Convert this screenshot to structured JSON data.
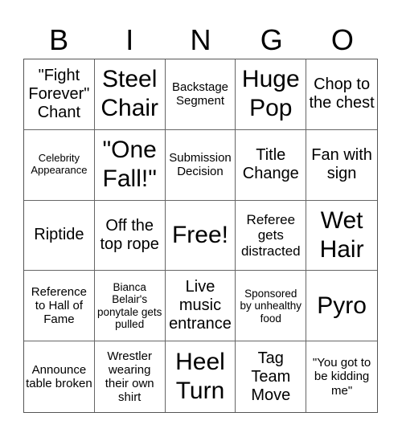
{
  "header": [
    "B",
    "I",
    "N",
    "G",
    "O"
  ],
  "cells": [
    {
      "text": "\"Fight Forever\" Chant",
      "size": "s2"
    },
    {
      "text": "Steel Chair",
      "size": "s1"
    },
    {
      "text": "Backstage Segment",
      "size": "s4"
    },
    {
      "text": "Huge Pop",
      "size": "s1"
    },
    {
      "text": "Chop to the chest",
      "size": "s2"
    },
    {
      "text": "Celebrity Appearance",
      "size": "s6"
    },
    {
      "text": "\"One Fall!\"",
      "size": "s1"
    },
    {
      "text": "Submission Decision",
      "size": "s4"
    },
    {
      "text": "Title Change",
      "size": "s2"
    },
    {
      "text": "Fan with sign",
      "size": "s2"
    },
    {
      "text": "Riptide",
      "size": "s2"
    },
    {
      "text": "Off the top rope",
      "size": "s2"
    },
    {
      "text": "Free!",
      "size": "s1"
    },
    {
      "text": "Referee gets distracted",
      "size": "s3"
    },
    {
      "text": "Wet Hair",
      "size": "s1"
    },
    {
      "text": "Reference to Hall of Fame",
      "size": "s4"
    },
    {
      "text": "Bianca Belair's ponytale gets pulled",
      "size": "s5"
    },
    {
      "text": "Live music entrance",
      "size": "s2"
    },
    {
      "text": "Sponsored by unhealthy food",
      "size": "s5"
    },
    {
      "text": "Pyro",
      "size": "s1"
    },
    {
      "text": "Announce table broken",
      "size": "s4"
    },
    {
      "text": "Wrestler wearing their own shirt",
      "size": "s4"
    },
    {
      "text": "Heel Turn",
      "size": "s1"
    },
    {
      "text": "Tag Team Move",
      "size": "s2"
    },
    {
      "text": "\"You got to be kidding me\"",
      "size": "s4"
    }
  ]
}
